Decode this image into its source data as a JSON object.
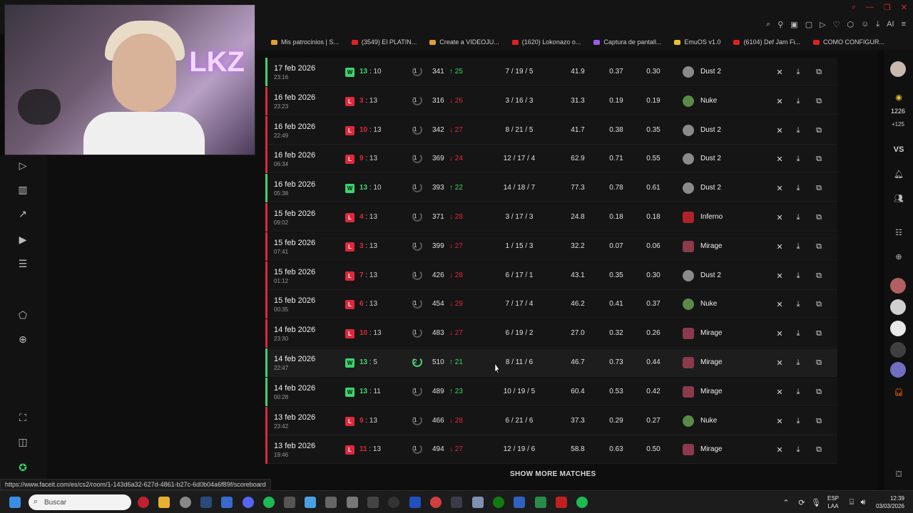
{
  "browser": {
    "bookmarks": [
      {
        "label": "Mis patrocinios | S...",
        "icon": "document-icon"
      },
      {
        "label": "(3549) El PLATIN...",
        "icon": "youtube-icon"
      },
      {
        "label": "Create a VIDEOJU...",
        "icon": "document-icon"
      },
      {
        "label": "(1620) Lokonazo o...",
        "icon": "youtube-icon"
      },
      {
        "label": "Captura de pantall...",
        "icon": "pen-icon"
      },
      {
        "label": "EmuOS v1.0",
        "icon": "star-icon"
      },
      {
        "label": "(6104) Def Jam Fi...",
        "icon": "youtube-icon"
      },
      {
        "label": "COMO CONFIGUR...",
        "icon": "youtube-icon"
      }
    ],
    "toolbar_ai_label": "AI",
    "status_url": "https://www.faceit.com/es/cs2/room/1-143d6a32-627d-4861-b27c-6d0b04a6f89f/scoreboard"
  },
  "matches": [
    {
      "date": "17 feb 2026",
      "time": "23:16",
      "result": "W",
      "my_score": "13",
      "opp_score": "10",
      "level": "1",
      "elo": "341",
      "delta": "25",
      "delta_dir": "up",
      "kda": "7 / 19 / 5",
      "adr": "41.9",
      "kr": "0.37",
      "kd": "0.30",
      "map": "Dust 2",
      "map_icon": "dust"
    },
    {
      "date": "16 feb 2026",
      "time": "23:23",
      "result": "L",
      "my_score": "3",
      "opp_score": "13",
      "level": "1",
      "elo": "316",
      "delta": "26",
      "delta_dir": "down",
      "kda": "3 / 16 / 3",
      "adr": "31.3",
      "kr": "0.19",
      "kd": "0.19",
      "map": "Nuke",
      "map_icon": "nuke"
    },
    {
      "date": "16 feb 2026",
      "time": "22:49",
      "result": "L",
      "my_score": "10",
      "opp_score": "13",
      "level": "1",
      "elo": "342",
      "delta": "27",
      "delta_dir": "down",
      "kda": "8 / 21 / 5",
      "adr": "41.7",
      "kr": "0.38",
      "kd": "0.35",
      "map": "Dust 2",
      "map_icon": "dust"
    },
    {
      "date": "16 feb 2026",
      "time": "06:34",
      "result": "L",
      "my_score": "9",
      "opp_score": "13",
      "level": "1",
      "elo": "369",
      "delta": "24",
      "delta_dir": "down",
      "kda": "12 / 17 / 4",
      "adr": "62.9",
      "kr": "0.71",
      "kd": "0.55",
      "map": "Dust 2",
      "map_icon": "dust"
    },
    {
      "date": "16 feb 2026",
      "time": "05:38",
      "result": "W",
      "my_score": "13",
      "opp_score": "10",
      "level": "1",
      "elo": "393",
      "delta": "22",
      "delta_dir": "up",
      "kda": "14 / 18 / 7",
      "adr": "77.3",
      "kr": "0.78",
      "kd": "0.61",
      "map": "Dust 2",
      "map_icon": "dust"
    },
    {
      "date": "15 feb 2026",
      "time": "09:02",
      "result": "L",
      "my_score": "4",
      "opp_score": "13",
      "level": "1",
      "elo": "371",
      "delta": "28",
      "delta_dir": "down",
      "kda": "3 / 17 / 3",
      "adr": "24.8",
      "kr": "0.18",
      "kd": "0.18",
      "map": "Inferno",
      "map_icon": "inferno"
    },
    {
      "date": "15 feb 2026",
      "time": "07:41",
      "result": "L",
      "my_score": "3",
      "opp_score": "13",
      "level": "1",
      "elo": "399",
      "delta": "27",
      "delta_dir": "down",
      "kda": "1 / 15 / 3",
      "adr": "32.2",
      "kr": "0.07",
      "kd": "0.06",
      "map": "Mirage",
      "map_icon": "mirage"
    },
    {
      "date": "15 feb 2026",
      "time": "01:12",
      "result": "L",
      "my_score": "7",
      "opp_score": "13",
      "level": "1",
      "elo": "426",
      "delta": "28",
      "delta_dir": "down",
      "kda": "6 / 17 / 1",
      "adr": "43.1",
      "kr": "0.35",
      "kd": "0.30",
      "map": "Dust 2",
      "map_icon": "dust"
    },
    {
      "date": "15 feb 2026",
      "time": "00:35",
      "result": "L",
      "my_score": "6",
      "opp_score": "13",
      "level": "1",
      "elo": "454",
      "delta": "29",
      "delta_dir": "down",
      "kda": "7 / 17 / 4",
      "adr": "46.2",
      "kr": "0.41",
      "kd": "0.37",
      "map": "Nuke",
      "map_icon": "nuke"
    },
    {
      "date": "14 feb 2026",
      "time": "23:30",
      "result": "L",
      "my_score": "10",
      "opp_score": "13",
      "level": "1",
      "elo": "483",
      "delta": "27",
      "delta_dir": "down",
      "kda": "6 / 19 / 2",
      "adr": "27.0",
      "kr": "0.32",
      "kd": "0.26",
      "map": "Mirage",
      "map_icon": "mirage"
    },
    {
      "date": "14 feb 2026",
      "time": "22:47",
      "result": "W",
      "my_score": "13",
      "opp_score": "5",
      "level": "2",
      "elo": "510",
      "delta": "21",
      "delta_dir": "up",
      "kda": "8 / 11 / 6",
      "adr": "46.7",
      "kr": "0.73",
      "kd": "0.44",
      "map": "Mirage",
      "map_icon": "mirage"
    },
    {
      "date": "14 feb 2026",
      "time": "00:28",
      "result": "W",
      "my_score": "13",
      "opp_score": "11",
      "level": "1",
      "elo": "489",
      "delta": "23",
      "delta_dir": "up",
      "kda": "10 / 19 / 5",
      "adr": "60.4",
      "kr": "0.53",
      "kd": "0.42",
      "map": "Mirage",
      "map_icon": "mirage"
    },
    {
      "date": "13 feb 2026",
      "time": "23:42",
      "result": "L",
      "my_score": "9",
      "opp_score": "13",
      "level": "1",
      "elo": "466",
      "delta": "28",
      "delta_dir": "down",
      "kda": "6 / 21 / 6",
      "adr": "37.3",
      "kr": "0.29",
      "kd": "0.27",
      "map": "Nuke",
      "map_icon": "nuke"
    },
    {
      "date": "13 feb 2026",
      "time": "19:46",
      "result": "L",
      "my_score": "11",
      "opp_score": "13",
      "level": "1",
      "elo": "494",
      "delta": "27",
      "delta_dir": "down",
      "kda": "12 / 19 / 6",
      "adr": "58.8",
      "kr": "0.63",
      "kd": "0.50",
      "map": "Mirage",
      "map_icon": "mirage"
    }
  ],
  "show_more_label": "SHOW MORE MATCHES",
  "right_sidebar": {
    "points_value": "1226",
    "points_delta": "+125",
    "vs_label": "VS",
    "friends_badge": "2",
    "party_badge": "5"
  },
  "webcam": {
    "neon_sign": "LKZ"
  },
  "taskbar": {
    "search_placeholder": "Buscar",
    "lang_line1": "ESP",
    "lang_line2": "LAA",
    "time": "12:39",
    "date": "03/03/2026"
  },
  "colors": {
    "win": "#3ad66a",
    "loss": "#e0283c",
    "background": "#0e0e0e",
    "row": "#151515"
  }
}
